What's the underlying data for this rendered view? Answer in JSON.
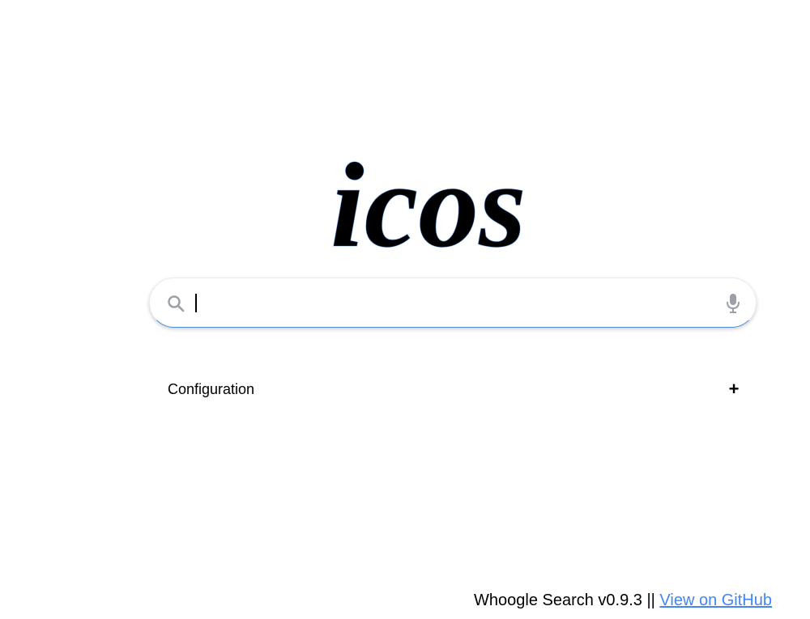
{
  "logo": {
    "text": "icos"
  },
  "search": {
    "value": "",
    "placeholder": "",
    "search_icon": "search-icon",
    "mic_icon": "microphone-icon"
  },
  "config": {
    "label": "Configuration",
    "toggle": "+"
  },
  "footer": {
    "version_text": "Whoogle Search v0.9.3 || ",
    "link_text": "View on GitHub"
  },
  "colors": {
    "accent": "#4285f4",
    "icon_gray": "#9aa0a6",
    "text": "#000000",
    "background": "#ffffff"
  }
}
